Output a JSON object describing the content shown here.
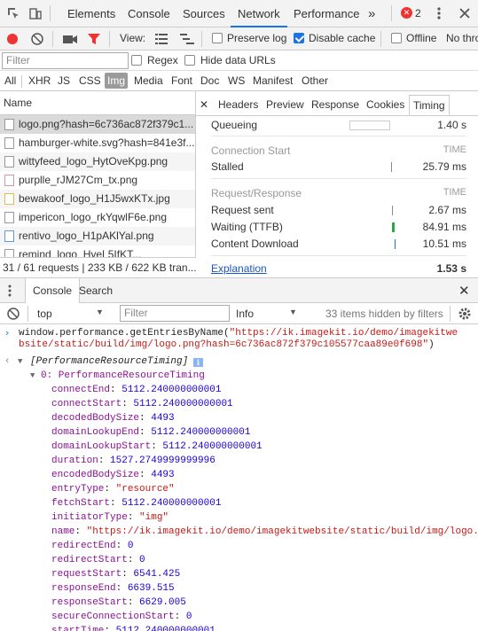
{
  "topbar": {
    "tabs": [
      "Elements",
      "Console",
      "Sources",
      "Network",
      "Performance"
    ],
    "more": "»",
    "error_count": "2",
    "error_badge": "✕",
    "active_tab": "Network"
  },
  "network_toolbar": {
    "view_label": "View:",
    "preserve_log": "Preserve log",
    "disable_cache": "Disable cache",
    "offline": "Offline",
    "throttle": "No thro"
  },
  "filter": {
    "placeholder": "Filter",
    "regex": "Regex",
    "hide_data_urls": "Hide data URLs"
  },
  "types": [
    "All",
    "XHR",
    "JS",
    "CSS",
    "Img",
    "Media",
    "Font",
    "Doc",
    "WS",
    "Manifest",
    "Other"
  ],
  "requests": {
    "header": "Name",
    "items": [
      "logo.png?hash=6c736ac872f379c1...",
      "hamburger-white.svg?hash=841e3f...",
      "wittyfeed_logo_HytOveKpg.png",
      "purplle_rJM27Cm_tx.png",
      "bewakoof_logo_H1J5wxKTx.jpg",
      "impericon_logo_rkYqwlF6e.png",
      "rentivo_logo_H1pAKlYal.png",
      "remind_logo_HyeL5IfKT..."
    ],
    "summary": "31 / 61 requests  |  233 KB / 622 KB tran..."
  },
  "detail": {
    "tabs": [
      "Headers",
      "Preview",
      "Response",
      "Cookies",
      "Timing"
    ],
    "close": "✕",
    "queueing_label": "Queueing",
    "queueing_val": "1.40 s",
    "conn_section": "Connection Start",
    "time_label": "TIME",
    "stalled_label": "Stalled",
    "stalled_val": "25.79 ms",
    "req_section": "Request/Response",
    "sent_label": "Request sent",
    "sent_val": "2.67 ms",
    "wait_label": "Waiting (TTFB)",
    "wait_val": "84.91 ms",
    "dl_label": "Content Download",
    "dl_val": "10.51 ms",
    "explanation": "Explanation",
    "total": "1.53 s"
  },
  "drawer": {
    "tabs": [
      "Console",
      "Search"
    ],
    "close": "✕",
    "context": "top",
    "filter_placeholder": "Filter",
    "level": "Info",
    "hidden": "33 items hidden by filters"
  },
  "console": {
    "cmd_1": "window.performance.getEntriesByName(",
    "cmd_url_1": "\"https://ik.imagekit.io/demo/imagekitwe",
    "cmd_url_2": "bsite/static/build/img/logo.png?hash=6c736ac872f379c105577caa89e0f698\"",
    "cmd_close": ")",
    "array_label": "[PerformanceResourceTiming]",
    "info_badge": "i",
    "obj_label": "0: PerformanceResourceTiming",
    "props": [
      {
        "k": "connectEnd",
        "v": "5112.240000000001",
        "t": "n"
      },
      {
        "k": "connectStart",
        "v": "5112.240000000001",
        "t": "n"
      },
      {
        "k": "decodedBodySize",
        "v": "4493",
        "t": "n"
      },
      {
        "k": "domainLookupEnd",
        "v": "5112.240000000001",
        "t": "n"
      },
      {
        "k": "domainLookupStart",
        "v": "5112.240000000001",
        "t": "n"
      },
      {
        "k": "duration",
        "v": "1527.2749999999996",
        "t": "n"
      },
      {
        "k": "encodedBodySize",
        "v": "4493",
        "t": "n"
      },
      {
        "k": "entryType",
        "v": "\"resource\"",
        "t": "s"
      },
      {
        "k": "fetchStart",
        "v": "5112.240000000001",
        "t": "n"
      },
      {
        "k": "initiatorType",
        "v": "\"img\"",
        "t": "s"
      },
      {
        "k": "name",
        "v": "\"https://ik.imagekit.io/demo/imagekitwebsite/static/build/img/logo.",
        "t": "s"
      },
      {
        "k": "redirectEnd",
        "v": "0",
        "t": "n"
      },
      {
        "k": "redirectStart",
        "v": "0",
        "t": "n"
      },
      {
        "k": "requestStart",
        "v": "6541.425",
        "t": "n"
      },
      {
        "k": "responseEnd",
        "v": "6639.515",
        "t": "n"
      },
      {
        "k": "responseStart",
        "v": "6629.005",
        "t": "n"
      },
      {
        "k": "secureConnectionStart",
        "v": "0",
        "t": "n"
      },
      {
        "k": "startTime",
        "v": "5112.240000000001",
        "t": "n"
      }
    ]
  },
  "colors": {
    "record": "#e33",
    "filter_icon": "#e33",
    "accent": "#1a73e8",
    "wait_bar": "#2da44e",
    "send_bar": "#888"
  }
}
